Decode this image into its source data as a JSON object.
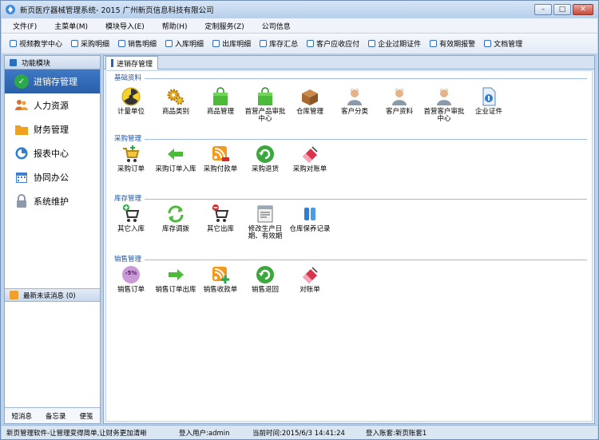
{
  "window": {
    "title": "新页医疗器械管理系统- 2015 广州新页信息科技有限公司",
    "minimize": "–",
    "maximize": "□",
    "close": "✕"
  },
  "menubar": [
    "文件(F)",
    "主菜单(M)",
    "模块导入(E)",
    "帮助(H)",
    "定制服务(Z)",
    "公司信息"
  ],
  "toolbar": [
    "视频教学中心",
    "采购明细",
    "销售明细",
    "入库明细",
    "出库明细",
    "库存汇总",
    "客户应收应付",
    "企业过期证件",
    "有效期报警",
    "文档管理"
  ],
  "sidebar": {
    "header": "功能模块",
    "items": [
      {
        "label": "进销存管理",
        "icon": "check-icon",
        "color": "#2aa84a",
        "active": true
      },
      {
        "label": "人力资源",
        "icon": "people-icon",
        "color": "#d9702e"
      },
      {
        "label": "财务管理",
        "icon": "folder-icon",
        "color": "#f0a21f"
      },
      {
        "label": "报表中心",
        "icon": "report-icon",
        "color": "#2e7fd1"
      },
      {
        "label": "协同办公",
        "icon": "calendar-icon",
        "color": "#3f7fd0"
      },
      {
        "label": "系统维护",
        "icon": "lock-icon",
        "color": "#8a99ab"
      }
    ],
    "messages": "最新未读消息 (0)",
    "footer": [
      "短消息",
      "备忘录",
      "便笺"
    ]
  },
  "tab": {
    "label": "进销存管理"
  },
  "sections": [
    {
      "title": "基础资料",
      "modules": [
        {
          "label": "计量单位",
          "icon": "radiation-icon"
        },
        {
          "label": "商品类别",
          "icon": "gears-icon"
        },
        {
          "label": "商品管理",
          "icon": "green-bag-icon"
        },
        {
          "label": "首营产品审批中心",
          "icon": "green-bag-icon"
        },
        {
          "label": "仓库管理",
          "icon": "warehouse-box-icon"
        },
        {
          "label": "客户分类",
          "icon": "person-icon"
        },
        {
          "label": "客户资料",
          "icon": "person-icon"
        },
        {
          "label": "首营客户审批中心",
          "icon": "person-icon"
        },
        {
          "label": "企业证件",
          "icon": "certificate-icon"
        }
      ]
    },
    {
      "title": "采购管理",
      "modules": [
        {
          "label": "采购订单",
          "icon": "cart-add-icon"
        },
        {
          "label": "采购订单入库",
          "icon": "arrow-left-icon"
        },
        {
          "label": "采购付款单",
          "icon": "rss-icon"
        },
        {
          "label": "采购退货",
          "icon": "refresh-circle-icon"
        },
        {
          "label": "采购对账单",
          "icon": "eraser-icon"
        }
      ]
    },
    {
      "title": "库存管理",
      "modules": [
        {
          "label": "其它入库",
          "icon": "cart-plus-icon"
        },
        {
          "label": "库存调拨",
          "icon": "sync-icon"
        },
        {
          "label": "其它出库",
          "icon": "cart-minus-icon"
        },
        {
          "label": "修改生产日期、有效期",
          "icon": "document-icon"
        },
        {
          "label": "仓库保养记录",
          "icon": "pillars-icon"
        }
      ]
    },
    {
      "title": "销售管理",
      "modules": [
        {
          "label": "销售订单",
          "icon": "discount-icon",
          "badge": "-5%"
        },
        {
          "label": "销售订单出库",
          "icon": "arrow-right-icon"
        },
        {
          "label": "销售收款单",
          "icon": "rss-add-icon"
        },
        {
          "label": "销售退回",
          "icon": "refresh-circle-icon"
        },
        {
          "label": "对账单",
          "icon": "eraser-icon"
        }
      ]
    }
  ],
  "status": {
    "slogan": "新页管理软件-让管理变得简单,让财务更加清晰",
    "user": "登入用户:admin",
    "time": "当前时间:2015/6/3 14:41:24",
    "account": "登入账套:新页账套1"
  }
}
